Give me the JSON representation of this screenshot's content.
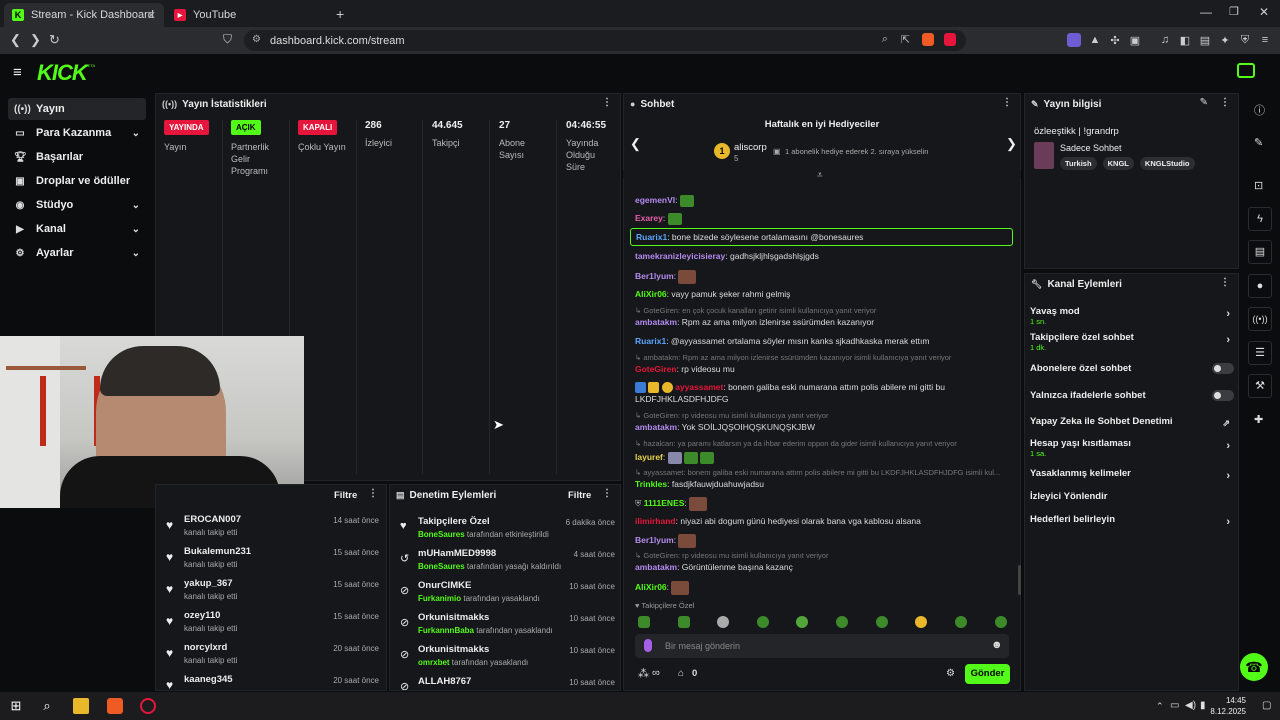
{
  "browser": {
    "tabs": [
      {
        "title": "Stream - Kick Dashboard",
        "active": true
      },
      {
        "title": "YouTube",
        "active": false
      }
    ],
    "url": "dashboard.kick.com/stream"
  },
  "sidebar": {
    "items": [
      {
        "label": "Yayın",
        "icon": "broadcast-icon"
      },
      {
        "label": "Para Kazanma",
        "icon": "money-icon"
      },
      {
        "label": "Başarılar",
        "icon": "trophy-icon"
      },
      {
        "label": "Droplar ve ödüller",
        "icon": "gift-icon"
      },
      {
        "label": "Stüdyo",
        "icon": "studio-icon"
      },
      {
        "label": "Kanal",
        "icon": "channel-icon"
      },
      {
        "label": "Ayarlar",
        "icon": "gear-icon"
      }
    ]
  },
  "stats": {
    "title": "Yayın İstatistikleri",
    "cols": [
      {
        "badge": "YAYINDA",
        "label": "Yayın",
        "color": "#e5153b"
      },
      {
        "badge": "AÇIK",
        "label": "Partnerlik Gelir Programı",
        "color": "#53fc18"
      },
      {
        "badge": "KAPALI",
        "label": "Çoklu Yayın",
        "color": "#e5153b"
      },
      {
        "value": "286",
        "label": "İzleyici"
      },
      {
        "value": "44.645",
        "label": "Takipçi"
      },
      {
        "value": "27",
        "label": "Abone Sayısı"
      },
      {
        "value": "04:46:55",
        "label": "Yayında Olduğu Süre"
      }
    ]
  },
  "followers": {
    "filter": "Filtre",
    "rows": [
      {
        "name": "EROCAN007",
        "sub": "kanalı takip etti",
        "time": "14 saat önce"
      },
      {
        "name": "Bukalemun231",
        "sub": "kanalı takip etti",
        "time": "15 saat önce"
      },
      {
        "name": "yakup_367",
        "sub": "kanalı takip etti",
        "time": "15 saat önce"
      },
      {
        "name": "ozey110",
        "sub": "kanalı takip etti",
        "time": "15 saat önce"
      },
      {
        "name": "norcylxrd",
        "sub": "kanalı takip etti",
        "time": "20 saat önce"
      },
      {
        "name": "kaaneg345",
        "sub": "",
        "time": "20 saat önce"
      }
    ]
  },
  "moderation": {
    "title": "Denetim Eylemleri",
    "filter": "Filtre",
    "rows": [
      {
        "name": "Takipçilere Özel",
        "by": "BoneSaures",
        "sub": " tarafından etkinleştirildi",
        "time": "6 dakika önce",
        "icon": "heart-icon"
      },
      {
        "name": "mUHamMED9998",
        "by": "BoneSaures",
        "sub": " tarafından yasağı kaldırıldı",
        "time": "4 saat önce",
        "icon": "undo-icon"
      },
      {
        "name": "OnurCIMKE",
        "by": "Furkanimio",
        "sub": " tarafından yasaklandı",
        "time": "10 saat önce",
        "icon": "ban-icon"
      },
      {
        "name": "Orkunisitmakks",
        "by": "FurkannnBaba",
        "sub": " tarafından yasaklandı",
        "time": "10 saat önce",
        "icon": "ban-icon"
      },
      {
        "name": "Orkunisitmakks",
        "by": "omrxbet",
        "sub": " tarafından yasaklandı",
        "time": "10 saat önce",
        "icon": "ban-icon"
      },
      {
        "name": "ALLAH8767",
        "by": "",
        "sub": "",
        "time": "10 saat önce",
        "icon": "ban-icon"
      }
    ]
  },
  "chat": {
    "title": "Sohbet",
    "gifters_title": "Haftalık en iyi Hediyeciler",
    "top_gifter": "aliscorp",
    "top_gifter_count": "5",
    "gift_hint": "1 abonelik hediye ederek 2. sıraya yükselin",
    "messages": [
      {
        "type": "msg",
        "user": "egemenVI",
        "color": "#b48bf0",
        "text": ""
      },
      {
        "type": "msg",
        "user": "Exarey",
        "color": "#e85fae",
        "text": ""
      },
      {
        "type": "highlight",
        "user": "Ruarix1",
        "color": "#5aa6ff",
        "text": "bone bizede söylesene ortalamasını @bonesaures"
      },
      {
        "type": "msg",
        "user": "tamekranizleyicisieray",
        "color": "#b48bf0",
        "text": "gadhsjkljhlşgadshlşjgds"
      },
      {
        "type": "msg",
        "user": "Ber1lyum",
        "color": "#b48bf0",
        "text": ""
      },
      {
        "type": "msg",
        "user": "AliXir06",
        "color": "#53fc18",
        "text": "vayy pamuk şeker rahmi gelmiş"
      },
      {
        "type": "reply",
        "text": "GoteGiren: en çok çocuk kanalları getirir isimli kullanıcıya yanıt veriyor"
      },
      {
        "type": "msg",
        "user": "ambatakm",
        "color": "#b48bf0",
        "text": "Rpm az ama milyon izlenirse ssürümden kazanıyor"
      },
      {
        "type": "msg",
        "user": "Ruarix1",
        "color": "#5aa6ff",
        "text": "@ayyassamet ortalama söyler mısın kanks sjkadhkaska merak ettım"
      },
      {
        "type": "reply",
        "text": "ambatakm: Rpm az ama milyon izlenirse ssürümden kazanıyor isimli kullanıcıya yanıt veriyor"
      },
      {
        "type": "msg",
        "user": "GoteGiren",
        "color": "#e5153b",
        "text": "rp videosu mu"
      },
      {
        "type": "msg",
        "user": "ayyassamet",
        "color": "#e5153b",
        "text": "bonem galiba eski numarana attım polis abilere mi gitti bu"
      },
      {
        "type": "cont",
        "text": "LKDFJHKLASDFHJDFG"
      },
      {
        "type": "reply",
        "text": "GoteGiren: rp videosu mu isimli kullanıcıya yanıt veriyor"
      },
      {
        "type": "msg",
        "user": "ambatakm",
        "color": "#b48bf0",
        "text": "Yok SOİLJQŞOIHQŞKUNQŞKJBW"
      },
      {
        "type": "reply",
        "text": "hazalcan: ya paramı katlarsın ya da ihbar ederim oppon da gider isimli kullanıcıya yanıt veriyor"
      },
      {
        "type": "msg",
        "user": "layuref",
        "color": "#e8d44d",
        "text": ""
      },
      {
        "type": "reply",
        "text": "ayyassamet: bonem galiba eski numarana attım polis abilere mi gitti bu LKDFJHKLASDFHJDFG isimli kul..."
      },
      {
        "type": "msg",
        "user": "Trinkles",
        "color": "#53fc18",
        "text": "fasdjkfauwjduahuwjadsu"
      },
      {
        "type": "msg",
        "user": "1111ENES",
        "color": "#53fc18",
        "text": ""
      },
      {
        "type": "msg",
        "user": "ilimirhand",
        "color": "#e5153b",
        "text": "niyazi abi dogum günü hediyesi olarak bana vga kablosu alsana"
      },
      {
        "type": "msg",
        "user": "Ber1lyum",
        "color": "#b48bf0",
        "text": ""
      },
      {
        "type": "reply",
        "text": "GoteGiren: rp videosu mu isimli kullanıcıya yanıt veriyor"
      },
      {
        "type": "msg",
        "user": "ambatakm",
        "color": "#b48bf0",
        "text": "Görüntülenme başına kazanç"
      },
      {
        "type": "msg",
        "user": "AliXir06",
        "color": "#53fc18",
        "text": ""
      }
    ],
    "mode_label": "Takipçilere Özel",
    "input_placeholder": "Bir mesaj gönderin",
    "send_label": "Gönder",
    "viewers_icon": "∞",
    "points": "0"
  },
  "stream_info": {
    "title": "Yayın bilgisi",
    "stream_title": "özleeştikk | !grandrp",
    "category": "Sadece Sohbet",
    "tags": [
      "Turkish",
      "KNGL",
      "KNGLStudio"
    ]
  },
  "channel_actions": {
    "title": "Kanal Eylemleri",
    "rows": [
      {
        "label": "Yavaş mod",
        "sub": "1 sn.",
        "kind": "chevron"
      },
      {
        "label": "Takipçilere özel sohbet",
        "sub": "1 dk.",
        "kind": "chevron"
      },
      {
        "label": "Abonelere özel sohbet",
        "sub": "",
        "kind": "toggle"
      },
      {
        "label": "Yalnızca ifadelerle sohbet",
        "sub": "",
        "kind": "toggle"
      },
      {
        "label": "Yapay Zeka ile Sohbet Denetimi",
        "sub": "",
        "kind": "external"
      },
      {
        "label": "Hesap yaşı kısıtlaması",
        "sub": "1 sa.",
        "kind": "chevron"
      },
      {
        "label": "Yasaklanmış kelimeler",
        "sub": "",
        "kind": "chevron"
      },
      {
        "label": "İzleyici Yönlendir",
        "sub": "",
        "kind": "none"
      },
      {
        "label": "Hedefleri belirleyin",
        "sub": "",
        "kind": "chevron"
      }
    ]
  },
  "taskbar": {
    "time": "14:45",
    "date": "8.12.2025"
  },
  "colors": {
    "accent": "#53fc18",
    "live": "#e5153b",
    "panel": "#16171a"
  }
}
